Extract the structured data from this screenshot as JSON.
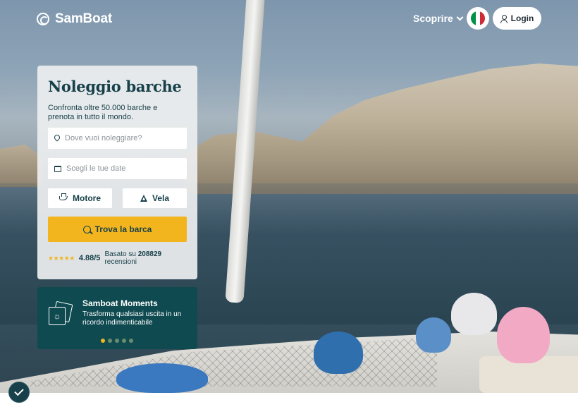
{
  "header": {
    "logo_text": "SamBoat",
    "discover_label": "Scoprire",
    "language_flag": "flag-italy-icon",
    "login_label": "Login"
  },
  "search_card": {
    "title": "Noleggio barche",
    "subtitle": "Confronta oltre 50.000 barche e prenota in tutto il mondo.",
    "location_placeholder": "Dove vuoi noleggiare?",
    "dates_placeholder": "Scegli le tue date",
    "motor_label": "Motore",
    "sail_label": "Vela",
    "find_button_label": "Trova la barca",
    "rating": {
      "stars": "★★★★★",
      "score": "4.88/5",
      "based_on": "Basato su",
      "count": "208829",
      "reviews_word": "recensioni"
    }
  },
  "moments_card": {
    "title": "Samboat Moments",
    "description": "Trasforma qualsiasi uscita in un ricordo indimenticabile",
    "carousel_total": 5,
    "carousel_active": 1
  },
  "colors": {
    "brand_dark": "#17404a",
    "accent_yellow": "#f3b51d",
    "moments_bg": "#0f4a50",
    "flag_green": "#009246",
    "flag_white": "#ffffff",
    "flag_red": "#ce2b37"
  },
  "icons": {
    "location": "map-pin-icon",
    "dates": "calendar-icon",
    "motor": "motorboat-icon",
    "sail": "sailboat-icon",
    "search": "search-icon",
    "user": "user-icon",
    "moments": "photos-icon",
    "badge": "check-icon"
  }
}
